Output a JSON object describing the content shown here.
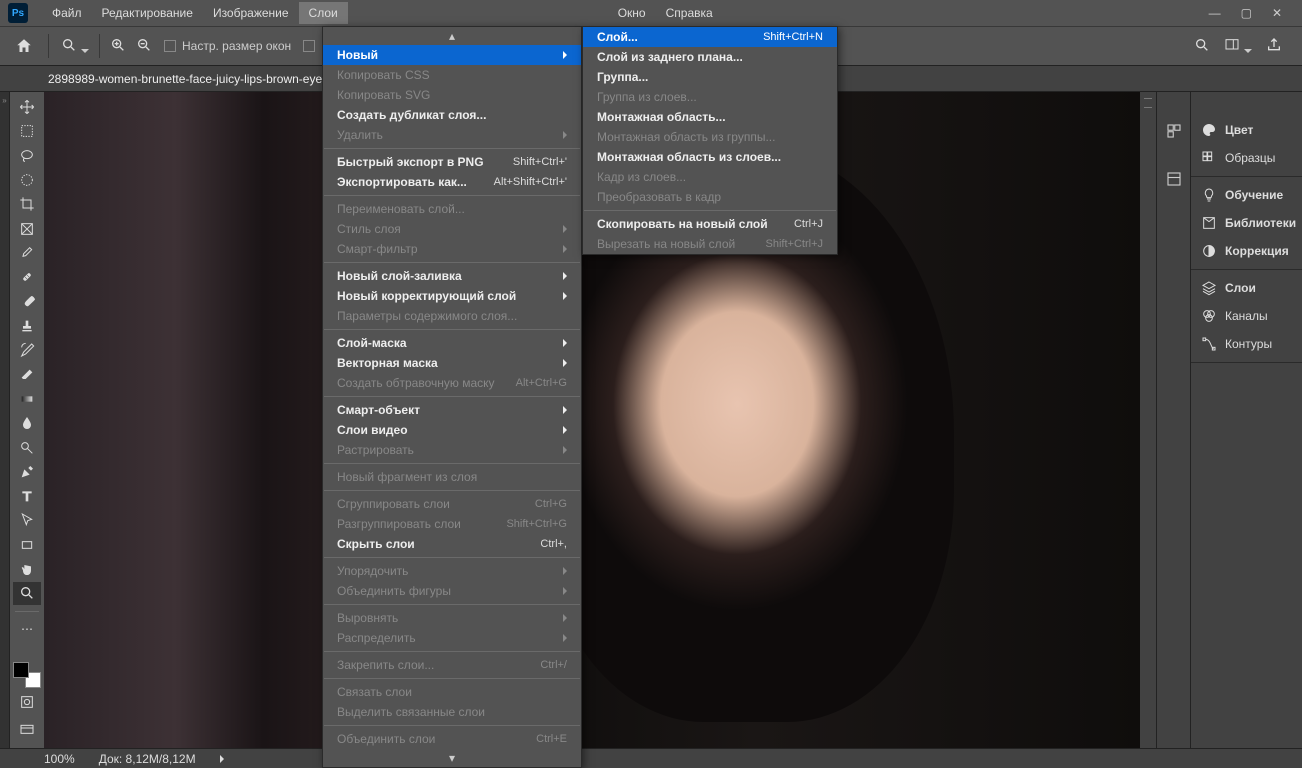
{
  "menubar": {
    "items": [
      "Файл",
      "Редактирование",
      "Изображение",
      "Слои",
      "Окно",
      "Справка"
    ],
    "active_index": 3
  },
  "optionsbar": {
    "resize_windows": "Настр. размер окон"
  },
  "doctab": "2898989-women-brunette-face-juicy-lips-brown-eye",
  "status": {
    "zoom": "100%",
    "docsize": "Док: 8,12M/8,12M"
  },
  "right_panel": {
    "group1": [
      {
        "icon": "palette",
        "label": "Цвет",
        "bold": true
      },
      {
        "icon": "swatches",
        "label": "Образцы"
      }
    ],
    "group2": [
      {
        "icon": "bulb",
        "label": "Обучение",
        "bold": true
      },
      {
        "icon": "libraries",
        "label": "Библиотеки",
        "bold": true
      },
      {
        "icon": "adjustments",
        "label": "Коррекция",
        "bold": true
      }
    ],
    "group3": [
      {
        "icon": "layers",
        "label": "Слои",
        "bold": true
      },
      {
        "icon": "channels",
        "label": "Каналы"
      },
      {
        "icon": "paths",
        "label": "Контуры"
      }
    ]
  },
  "menu_layers": [
    {
      "type": "scroll"
    },
    {
      "label": "Новый",
      "arrow": true,
      "highlight": true,
      "bold": true
    },
    {
      "label": "Копировать CSS",
      "disabled": true
    },
    {
      "label": "Копировать SVG",
      "disabled": true
    },
    {
      "label": "Создать дубликат слоя...",
      "bold": true
    },
    {
      "label": "Удалить",
      "arrow": true,
      "disabled": true
    },
    {
      "type": "sep"
    },
    {
      "label": "Быстрый экспорт в PNG",
      "shortcut": "Shift+Ctrl+'",
      "bold": true
    },
    {
      "label": "Экспортировать как...",
      "shortcut": "Alt+Shift+Ctrl+'",
      "bold": true
    },
    {
      "type": "sep"
    },
    {
      "label": "Переименовать слой...",
      "disabled": true
    },
    {
      "label": "Стиль слоя",
      "arrow": true,
      "disabled": true
    },
    {
      "label": "Смарт-фильтр",
      "arrow": true,
      "disabled": true
    },
    {
      "type": "sep"
    },
    {
      "label": "Новый слой-заливка",
      "arrow": true,
      "bold": true
    },
    {
      "label": "Новый корректирующий слой",
      "arrow": true,
      "bold": true
    },
    {
      "label": "Параметры содержимого слоя...",
      "disabled": true
    },
    {
      "type": "sep"
    },
    {
      "label": "Слой-маска",
      "arrow": true,
      "bold": true
    },
    {
      "label": "Векторная маска",
      "arrow": true,
      "bold": true
    },
    {
      "label": "Создать обтравочную маску",
      "shortcut": "Alt+Ctrl+G",
      "disabled": true
    },
    {
      "type": "sep"
    },
    {
      "label": "Смарт-объект",
      "arrow": true,
      "bold": true
    },
    {
      "label": "Слои видео",
      "arrow": true,
      "bold": true
    },
    {
      "label": "Растрировать",
      "arrow": true,
      "disabled": true
    },
    {
      "type": "sep"
    },
    {
      "label": "Новый фрагмент из слоя",
      "disabled": true
    },
    {
      "type": "sep"
    },
    {
      "label": "Сгруппировать слои",
      "shortcut": "Ctrl+G",
      "disabled": true
    },
    {
      "label": "Разгруппировать слои",
      "shortcut": "Shift+Ctrl+G",
      "disabled": true
    },
    {
      "label": "Скрыть слои",
      "shortcut": "Ctrl+,",
      "bold": true
    },
    {
      "type": "sep"
    },
    {
      "label": "Упорядочить",
      "arrow": true,
      "disabled": true
    },
    {
      "label": "Объединить фигуры",
      "arrow": true,
      "disabled": true
    },
    {
      "type": "sep"
    },
    {
      "label": "Выровнять",
      "arrow": true,
      "disabled": true
    },
    {
      "label": "Распределить",
      "arrow": true,
      "disabled": true
    },
    {
      "type": "sep"
    },
    {
      "label": "Закрепить слои...",
      "shortcut": "Ctrl+/",
      "disabled": true
    },
    {
      "type": "sep"
    },
    {
      "label": "Связать слои",
      "disabled": true
    },
    {
      "label": "Выделить связанные слои",
      "disabled": true
    },
    {
      "type": "sep"
    },
    {
      "label": "Объединить слои",
      "shortcut": "Ctrl+E",
      "disabled": true
    },
    {
      "type": "scroll-down"
    }
  ],
  "menu_new_sub": [
    {
      "label": "Слой...",
      "shortcut": "Shift+Ctrl+N",
      "highlight": true,
      "bold": true
    },
    {
      "label": "Слой из заднего плана...",
      "bold": true
    },
    {
      "label": "Группа...",
      "bold": true
    },
    {
      "label": "Группа из слоев...",
      "disabled": true
    },
    {
      "label": "Монтажная область...",
      "bold": true
    },
    {
      "label": "Монтажная область из группы...",
      "disabled": true
    },
    {
      "label": "Монтажная область из слоев...",
      "bold": true
    },
    {
      "label": "Кадр из слоев...",
      "disabled": true
    },
    {
      "label": "Преобразовать в кадр",
      "disabled": true
    },
    {
      "type": "sep"
    },
    {
      "label": "Скопировать на новый слой",
      "shortcut": "Ctrl+J",
      "bold": true
    },
    {
      "label": "Вырезать на новый слой",
      "shortcut": "Shift+Ctrl+J",
      "disabled": true
    }
  ]
}
